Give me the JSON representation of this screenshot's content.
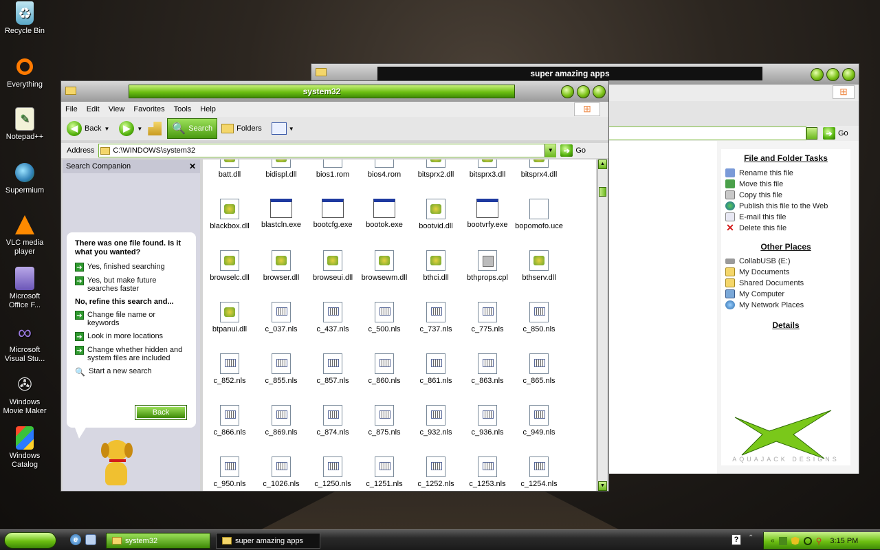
{
  "desktop": {
    "icons": [
      {
        "label": "Recycle Bin",
        "icon": "recycle-bin-icon"
      },
      {
        "label": "Everything",
        "icon": "everything-icon"
      },
      {
        "label": "Notepad++",
        "icon": "notepad-icon"
      },
      {
        "label": "Supermium",
        "icon": "supermium-icon"
      },
      {
        "label": "VLC media player",
        "icon": "vlc-icon"
      },
      {
        "label": "Microsoft Office F...",
        "icon": "office-icon"
      },
      {
        "label": "Microsoft Visual Stu...",
        "icon": "visual-studio-icon"
      },
      {
        "label": "Windows Movie Maker",
        "icon": "movie-maker-icon"
      },
      {
        "label": "Windows Catalog",
        "icon": "catalog-icon"
      }
    ]
  },
  "back_window": {
    "title": "super amazing apps",
    "go_label": "Go",
    "tasks_title": "File and Folder Tasks",
    "tasks": [
      {
        "label": "Rename this file",
        "icon": "rename-icon"
      },
      {
        "label": "Move this file",
        "icon": "move-icon"
      },
      {
        "label": "Copy this file",
        "icon": "copy-icon"
      },
      {
        "label": "Publish this file to the Web",
        "icon": "web-publish-icon"
      },
      {
        "label": "E-mail this file",
        "icon": "email-icon"
      },
      {
        "label": "Delete this file",
        "icon": "delete-icon"
      }
    ],
    "places_title": "Other Places",
    "places": [
      {
        "label": "CollabUSB (E:)",
        "icon": "drive-icon"
      },
      {
        "label": "My Documents",
        "icon": "folder-icon"
      },
      {
        "label": "Shared Documents",
        "icon": "folder-icon"
      },
      {
        "label": "My Computer",
        "icon": "computer-icon"
      },
      {
        "label": "My Network Places",
        "icon": "network-icon"
      }
    ],
    "details_title": "Details",
    "logo_text": "AQUAJACK DESIGNS"
  },
  "front_window": {
    "title": "system32",
    "menu": [
      "File",
      "Edit",
      "View",
      "Favorites",
      "Tools",
      "Help"
    ],
    "toolbar": {
      "back": "Back",
      "search": "Search",
      "folders": "Folders"
    },
    "address_label": "Address",
    "address_value": "C:\\WINDOWS\\system32",
    "go_label": "Go",
    "search_companion": {
      "title": "Search Companion",
      "result_text": "There was one file found.  Is it what you wanted?",
      "options": [
        "Yes, finished searching",
        "Yes, but make future searches faster"
      ],
      "refine_heading": "No, refine this search and...",
      "refine_options": [
        "Change file name or keywords",
        "Look in more locations",
        "Change whether hidden and system files are included"
      ],
      "start_new": "Start a new search",
      "back_button": "Back"
    },
    "files": [
      {
        "name": "batt.dll",
        "type": "dll"
      },
      {
        "name": "bidispl.dll",
        "type": "dll"
      },
      {
        "name": "bios1.rom",
        "type": "rom"
      },
      {
        "name": "bios4.rom",
        "type": "rom"
      },
      {
        "name": "bitsprx2.dll",
        "type": "dll"
      },
      {
        "name": "bitsprx3.dll",
        "type": "dll"
      },
      {
        "name": "bitsprx4.dll",
        "type": "dll"
      },
      {
        "name": "blackbox.dll",
        "type": "dll"
      },
      {
        "name": "blastcln.exe",
        "type": "exe"
      },
      {
        "name": "bootcfg.exe",
        "type": "exe"
      },
      {
        "name": "bootok.exe",
        "type": "exe"
      },
      {
        "name": "bootvid.dll",
        "type": "dll"
      },
      {
        "name": "bootvrfy.exe",
        "type": "exe"
      },
      {
        "name": "bopomofo.uce",
        "type": "uce"
      },
      {
        "name": "browselc.dll",
        "type": "dll"
      },
      {
        "name": "browser.dll",
        "type": "dll"
      },
      {
        "name": "browseui.dll",
        "type": "dll"
      },
      {
        "name": "browsewm.dll",
        "type": "dll"
      },
      {
        "name": "bthci.dll",
        "type": "dll"
      },
      {
        "name": "bthprops.cpl",
        "type": "cpl"
      },
      {
        "name": "bthserv.dll",
        "type": "dll"
      },
      {
        "name": "btpanui.dll",
        "type": "dll"
      },
      {
        "name": "c_037.nls",
        "type": "nls"
      },
      {
        "name": "c_437.nls",
        "type": "nls"
      },
      {
        "name": "c_500.nls",
        "type": "nls"
      },
      {
        "name": "c_737.nls",
        "type": "nls"
      },
      {
        "name": "c_775.nls",
        "type": "nls"
      },
      {
        "name": "c_850.nls",
        "type": "nls"
      },
      {
        "name": "c_852.nls",
        "type": "nls"
      },
      {
        "name": "c_855.nls",
        "type": "nls"
      },
      {
        "name": "c_857.nls",
        "type": "nls"
      },
      {
        "name": "c_860.nls",
        "type": "nls"
      },
      {
        "name": "c_861.nls",
        "type": "nls"
      },
      {
        "name": "c_863.nls",
        "type": "nls"
      },
      {
        "name": "c_865.nls",
        "type": "nls"
      },
      {
        "name": "c_866.nls",
        "type": "nls"
      },
      {
        "name": "c_869.nls",
        "type": "nls"
      },
      {
        "name": "c_874.nls",
        "type": "nls"
      },
      {
        "name": "c_875.nls",
        "type": "nls"
      },
      {
        "name": "c_932.nls",
        "type": "nls"
      },
      {
        "name": "c_936.nls",
        "type": "nls"
      },
      {
        "name": "c_949.nls",
        "type": "nls"
      },
      {
        "name": "c_950.nls",
        "type": "nls"
      },
      {
        "name": "c_1026.nls",
        "type": "nls"
      },
      {
        "name": "c_1250.nls",
        "type": "nls"
      },
      {
        "name": "c_1251.nls",
        "type": "nls"
      },
      {
        "name": "c_1252.nls",
        "type": "nls"
      },
      {
        "name": "c_1253.nls",
        "type": "nls"
      },
      {
        "name": "c_1254.nls",
        "type": "nls"
      }
    ]
  },
  "taskbar": {
    "items": [
      "system32",
      "super amazing apps"
    ],
    "clock": "3:15 PM"
  },
  "colors": {
    "accent": "#6fc21a",
    "accent_dark": "#2d6a04",
    "titlebar_dark": "#1a1a1a"
  }
}
